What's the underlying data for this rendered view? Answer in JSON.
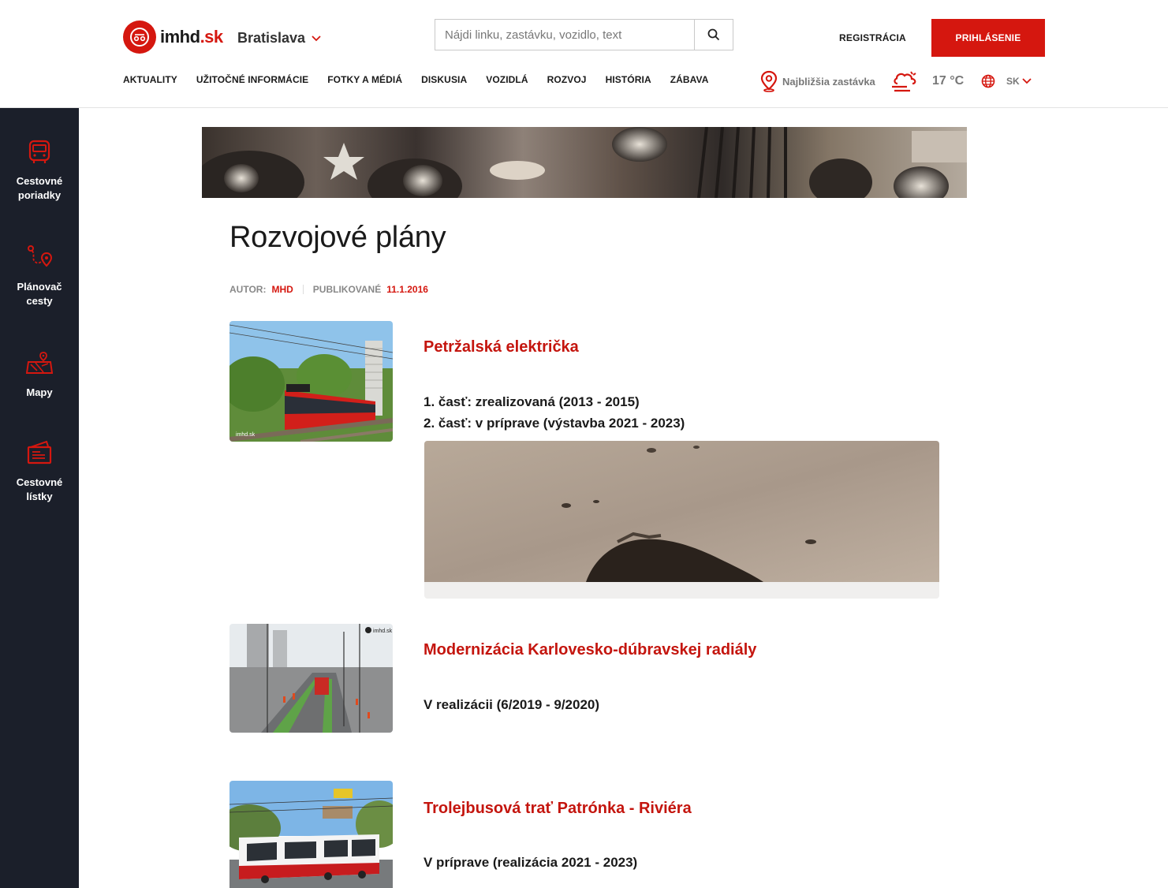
{
  "header": {
    "logo_text": "imhd",
    "logo_tld": ".sk",
    "city": "Bratislava",
    "search_placeholder": "Nájdi linku, zastávku, vozidlo, text",
    "register_label": "REGISTRÁCIA",
    "login_label": "PRIHLÁSENIE",
    "nav": [
      "AKTUALITY",
      "UŽITOČNÉ INFORMÁCIE",
      "FOTKY A MÉDIÁ",
      "DISKUSIA",
      "VOZIDLÁ",
      "ROZVOJ",
      "HISTÓRIA",
      "ZÁBAVA"
    ],
    "nearest_stop": "Najbližšia zastávka",
    "temperature": "17 °C",
    "language": "SK"
  },
  "sidebar": {
    "items": [
      {
        "label": "Cestovné\nporiadky",
        "icon": "bus-icon"
      },
      {
        "label": "Plánovač\ncesty",
        "icon": "route-planner-icon"
      },
      {
        "label": "Mapy",
        "icon": "map-icon"
      },
      {
        "label": "Cestovné\nlístky",
        "icon": "ticket-icon"
      }
    ]
  },
  "page": {
    "title": "Rozvojové plány",
    "author_label": "AUTOR:",
    "author": "MHD",
    "published_label": "PUBLIKOVANÉ",
    "published_date": "11.1.2016"
  },
  "articles": [
    {
      "title": "Petržalská električka",
      "lines": [
        "1. časť: zrealizovaná (2013 - 2015)",
        "2. časť: v príprave (výstavba 2021 - 2023)"
      ]
    },
    {
      "title": "Modernizácia Karlovesko-dúbravskej radiály",
      "lines": [
        "V realizácii (6/2019 - 9/2020)"
      ]
    },
    {
      "title": "Trolejbusová trať Patrónka - Riviéra",
      "lines": [
        "V príprave (realizácia 2021 - 2023)"
      ]
    }
  ],
  "colors": {
    "brand": "#d5170f",
    "sidebar": "#1b1f2a",
    "title_red": "#c4150e"
  }
}
